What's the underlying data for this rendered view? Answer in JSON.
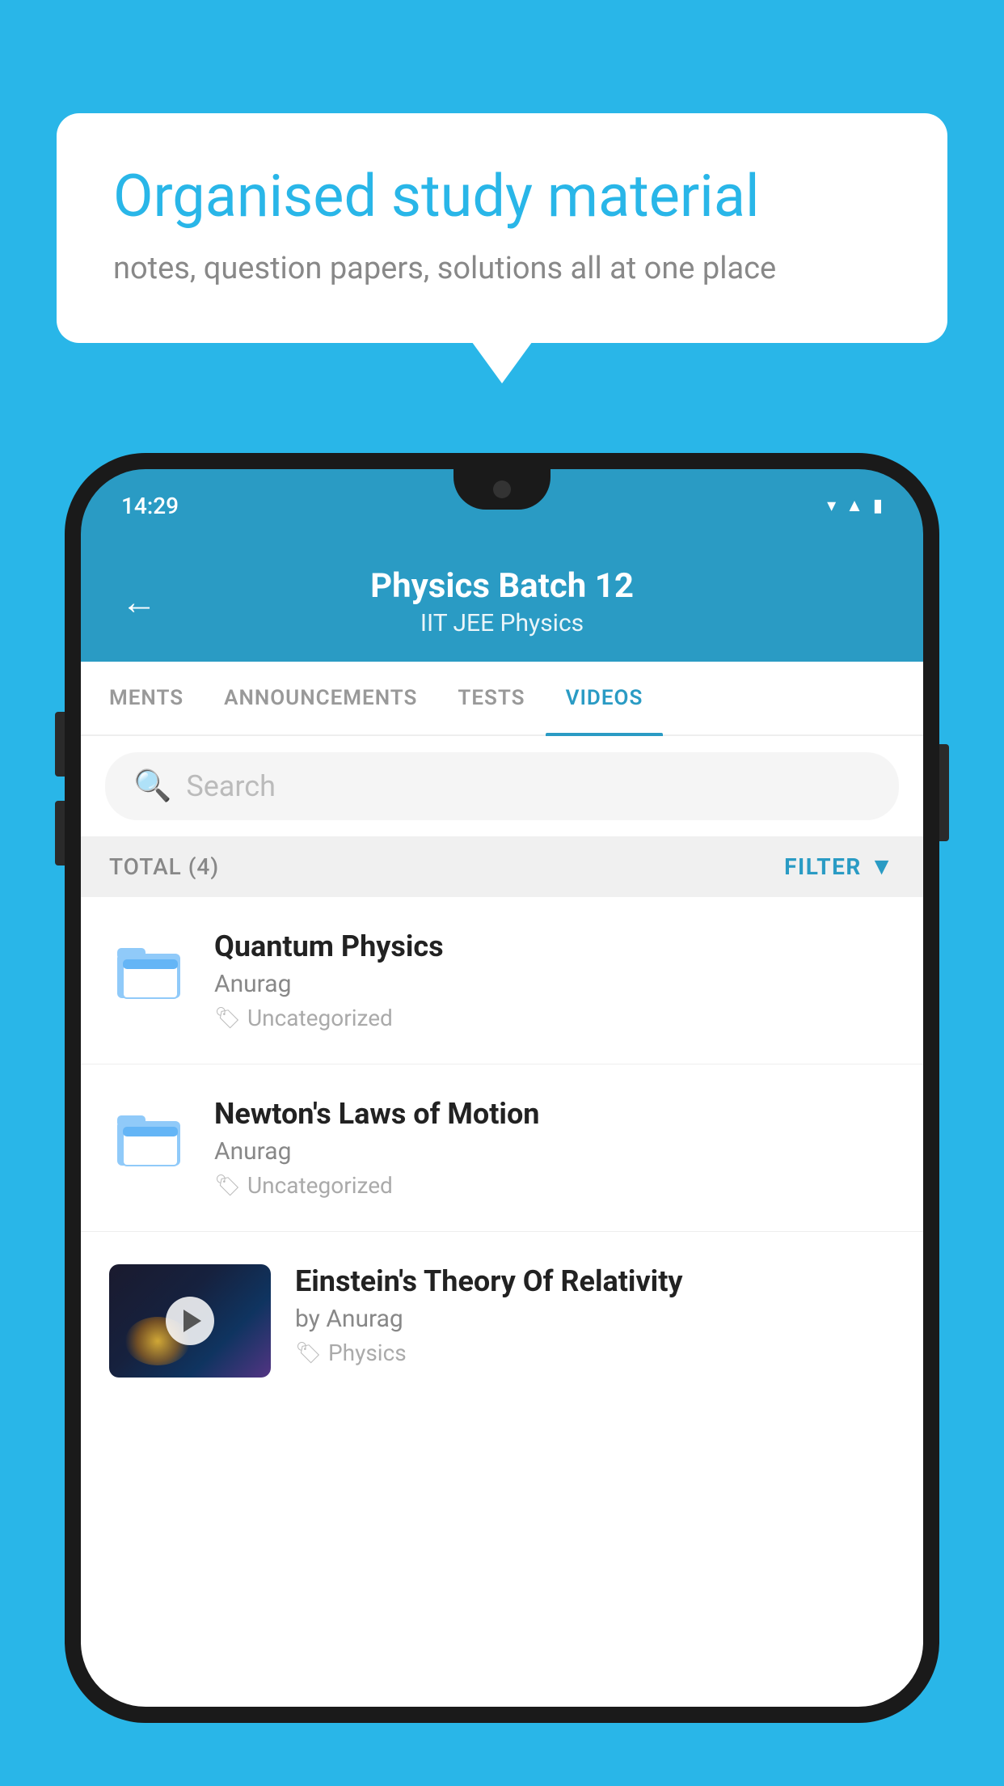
{
  "background_color": "#29B6E8",
  "speech_bubble": {
    "title": "Organised study material",
    "subtitle": "notes, question papers, solutions all at one place"
  },
  "phone": {
    "status_bar": {
      "time": "14:29"
    },
    "header": {
      "title": "Physics Batch 12",
      "subtitle": "IIT JEE   Physics",
      "back_label": "←"
    },
    "tabs": [
      {
        "label": "MENTS",
        "active": false
      },
      {
        "label": "ANNOUNCEMENTS",
        "active": false
      },
      {
        "label": "TESTS",
        "active": false
      },
      {
        "label": "VIDEOS",
        "active": true
      }
    ],
    "search": {
      "placeholder": "Search"
    },
    "filter": {
      "total_label": "TOTAL (4)",
      "filter_label": "FILTER"
    },
    "videos": [
      {
        "title": "Quantum Physics",
        "author": "Anurag",
        "tag": "Uncategorized",
        "type": "folder"
      },
      {
        "title": "Newton's Laws of Motion",
        "author": "Anurag",
        "tag": "Uncategorized",
        "type": "folder"
      },
      {
        "title": "Einstein's Theory Of Relativity",
        "author": "by Anurag",
        "tag": "Physics",
        "type": "video"
      }
    ]
  }
}
